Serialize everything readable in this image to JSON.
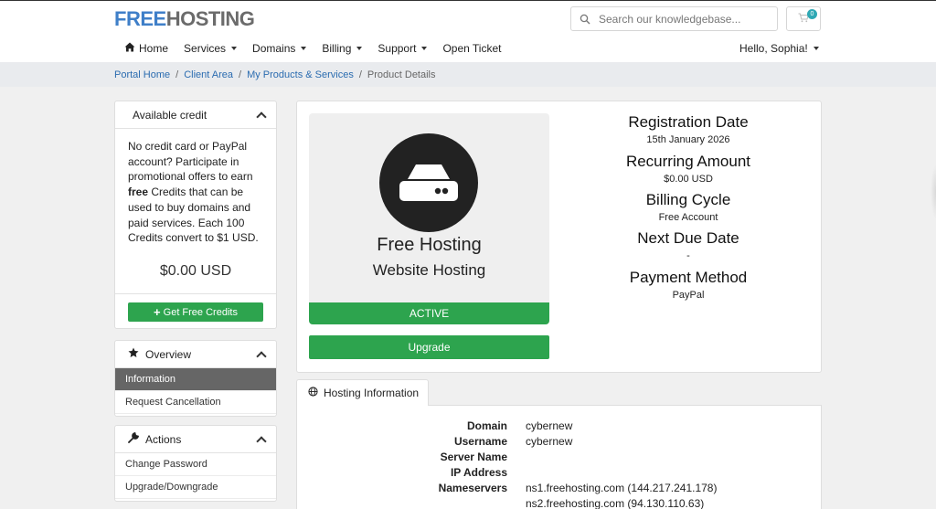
{
  "header": {
    "logo_part1": "FREE",
    "logo_part2": "HOSTING",
    "search_placeholder": "Search our knowledgebase...",
    "cart_count": "0"
  },
  "nav": {
    "home": "Home",
    "services": "Services",
    "domains": "Domains",
    "billing": "Billing",
    "support": "Support",
    "open_ticket": "Open Ticket",
    "user_greeting": "Hello, Sophia!"
  },
  "breadcrumb": {
    "items": [
      "Portal Home",
      "Client Area",
      "My Products & Services"
    ],
    "current": "Product Details",
    "separator": "/"
  },
  "credit_panel": {
    "title": "Available credit",
    "text_before": "No credit card or PayPal account? Participate in promotional offers to earn ",
    "text_bold": "free",
    "text_after": " Credits that can be used to buy domains and paid services. Each 100 Credits convert to $1 USD.",
    "amount": "$0.00 USD",
    "button": "Get Free Credits"
  },
  "overview_panel": {
    "title": "Overview",
    "items": [
      "Information",
      "Request Cancellation"
    ]
  },
  "actions_panel": {
    "title": "Actions",
    "items": [
      "Change Password",
      "Upgrade/Downgrade"
    ]
  },
  "product": {
    "name": "Free Hosting",
    "group": "Website Hosting",
    "status": "ACTIVE",
    "upgrade_button": "Upgrade"
  },
  "details": {
    "registration_label": "Registration Date",
    "registration_value": "15th January 2026",
    "recurring_label": "Recurring Amount",
    "recurring_value": "$0.00 USD",
    "cycle_label": "Billing Cycle",
    "cycle_value": "Free Account",
    "due_label": "Next Due Date",
    "due_value": "-",
    "payment_label": "Payment Method",
    "payment_value": "PayPal"
  },
  "hosting_info": {
    "tab_label": "Hosting Information",
    "domain_label": "Domain",
    "domain_value": "cybernew",
    "username_label": "Username",
    "username_value": "cybernew",
    "server_label": "Server Name",
    "server_value": "",
    "ip_label": "IP Address",
    "ip_value": "",
    "ns_label": "Nameservers",
    "ns1": "ns1.freehosting.com (144.217.241.178)",
    "ns2": "ns2.freehosting.com (94.130.110.63)"
  },
  "colors": {
    "brand_blue": "#3f7fc8",
    "brand_gray": "#6b6b6b",
    "success_green": "#2da44e",
    "link_blue": "#2b6cb0"
  },
  "icons": {
    "home": "home-icon",
    "search": "search-icon",
    "cart": "cart-icon",
    "star": "star-icon",
    "wrench": "wrench-icon",
    "globe": "globe-icon",
    "server": "server-icon",
    "plus": "plus-icon"
  }
}
